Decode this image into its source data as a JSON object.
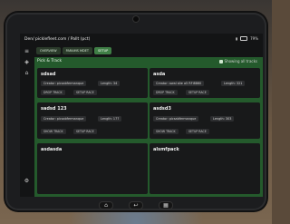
{
  "device": {
    "title": "Den/ picklefleet.com / Pallt (pct)",
    "status": {
      "signal": "▮",
      "battery_percent": "79%"
    }
  },
  "tabs": [
    {
      "label": "OVERVIEW"
    },
    {
      "label": "PARAMS MDET"
    },
    {
      "label": "SETUP"
    }
  ],
  "panel": {
    "title": "Pick & Track",
    "toggle_label": "Showing all tracks"
  },
  "cards": [
    {
      "name": "sdsad",
      "pills": [
        "Creator: picsabfermanque",
        "Length: 34"
      ],
      "buttons": [
        "DROP TRACK",
        "SETUP RACE"
      ]
    },
    {
      "name": "asda",
      "pills": [
        "Creator: awal site a5 RFI8860",
        "Length: 321"
      ],
      "buttons": [
        "DROP TRACK",
        "SETUP RACE"
      ]
    },
    {
      "name": "sadsd 123",
      "pills": [
        "Creator: picsabfermanque",
        "Length: 177"
      ],
      "buttons": [
        "SHOW TRACK",
        "SETUP RACE"
      ]
    },
    {
      "name": "asdsd3",
      "pills": [
        "Creator: picsabfermanque",
        "Length: 303"
      ],
      "buttons": [
        "SHOW TRACK",
        "SETUP RACE"
      ]
    },
    {
      "name": "asdasda",
      "pills": [],
      "buttons": []
    },
    {
      "name": "alsmfpack",
      "pills": [],
      "buttons": []
    }
  ],
  "colors": {
    "panel_green": "#245a2c",
    "active_tab": "#3f7f46",
    "card": "#18191a"
  },
  "icons": {
    "rail": [
      "menu-icon",
      "layers-icon",
      "filter-icon",
      "settings-icon"
    ],
    "bottom": [
      "home-icon",
      "back-icon",
      "apps-icon"
    ]
  }
}
